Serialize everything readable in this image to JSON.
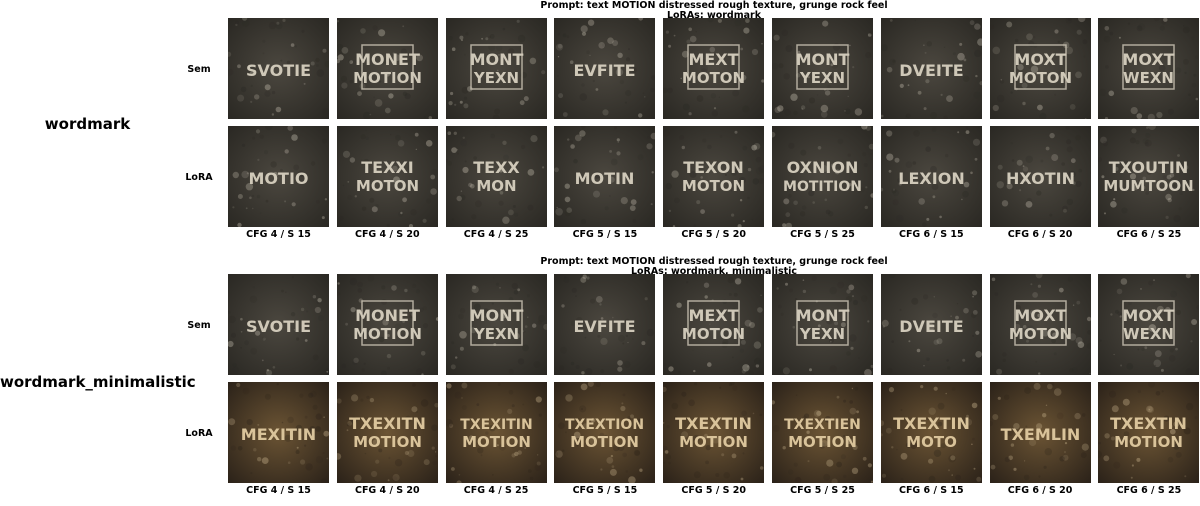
{
  "groups": [
    {
      "name": "wordmark",
      "prompt": "Prompt: text MOTION distressed rough texture, grunge rock feel",
      "loras": "LoRAs: wordmark",
      "rows": [
        {
          "label": "Sem",
          "tint": "gray",
          "tiles": [
            {
              "l1": "SVOTIE",
              "l2": ""
            },
            {
              "l1": "MONET",
              "l2": "MOTION"
            },
            {
              "l1": "MONT",
              "l2": "YEXN"
            },
            {
              "l1": "EVFITE",
              "l2": ""
            },
            {
              "l1": "MEXT",
              "l2": "MOTON"
            },
            {
              "l1": "MONT",
              "l2": "YEXN"
            },
            {
              "l1": "DVEITE",
              "l2": ""
            },
            {
              "l1": "MOXT",
              "l2": "MOTON"
            },
            {
              "l1": "MOXT",
              "l2": "WEXN"
            }
          ]
        },
        {
          "label": "LoRA",
          "tint": "gray",
          "tiles": [
            {
              "l1": "MOTIO",
              "l2": ""
            },
            {
              "l1": "TEXXI",
              "l2": "MOTON"
            },
            {
              "l1": "TEXX",
              "l2": "MON"
            },
            {
              "l1": "MOTIN",
              "l2": ""
            },
            {
              "l1": "TEXON",
              "l2": "MOTON"
            },
            {
              "l1": "OXNION",
              "l2": "MOTITION"
            },
            {
              "l1": "LEXION",
              "l2": ""
            },
            {
              "l1": "HXOTIN",
              "l2": ""
            },
            {
              "l1": "TXOUTIN",
              "l2": "MUMTOON"
            }
          ]
        }
      ],
      "columns": [
        "CFG 4 / S 15",
        "CFG 4 / S 20",
        "CFG 4 / S 25",
        "CFG 5 / S 15",
        "CFG 5 / S 20",
        "CFG 5 / S 25",
        "CFG 6 / S 15",
        "CFG 6 / S 20",
        "CFG 6 / S 25"
      ]
    },
    {
      "name": "wordmark_minimalistic",
      "prompt": "Prompt: text MOTION distressed rough texture, grunge rock feel",
      "loras": "LoRAs: wordmark, minimalistic",
      "rows": [
        {
          "label": "Sem",
          "tint": "gray",
          "tiles": [
            {
              "l1": "SVOTIE",
              "l2": ""
            },
            {
              "l1": "MONET",
              "l2": "MOTION"
            },
            {
              "l1": "MONT",
              "l2": "YEXN"
            },
            {
              "l1": "EVFITE",
              "l2": ""
            },
            {
              "l1": "MEXT",
              "l2": "MOTON"
            },
            {
              "l1": "MONT",
              "l2": "YEXN"
            },
            {
              "l1": "DVEITE",
              "l2": ""
            },
            {
              "l1": "MOXT",
              "l2": "MOTON"
            },
            {
              "l1": "MOXT",
              "l2": "WEXN"
            }
          ]
        },
        {
          "label": "LoRA",
          "tint": "brown",
          "tiles": [
            {
              "l1": "MEXITIN",
              "l2": ""
            },
            {
              "l1": "TXEXITN",
              "l2": "MOTION"
            },
            {
              "l1": "TXEXITIN",
              "l2": "MOTION"
            },
            {
              "l1": "TXEXTION",
              "l2": "MOTION"
            },
            {
              "l1": "TXEXTIN",
              "l2": "MOTION"
            },
            {
              "l1": "TXEXTIEN",
              "l2": "MOTION"
            },
            {
              "l1": "TXEXTIN",
              "l2": "MOTO"
            },
            {
              "l1": "TXEMLIN",
              "l2": ""
            },
            {
              "l1": "TXEXTIN",
              "l2": "MOTION"
            }
          ]
        }
      ],
      "columns": [
        "CFG 4 / S 15",
        "CFG 4 / S 20",
        "CFG 4 / S 25",
        "CFG 5 / S 15",
        "CFG 5 / S 20",
        "CFG 5 / S 25",
        "CFG 6 / S 15",
        "CFG 6 / S 20",
        "CFG 6 / S 25"
      ]
    }
  ],
  "palette": {
    "gray_bg": "#4b473f",
    "gray_dark": "#2a2823",
    "gray_text": "#cfc8b8",
    "brown_bg": "#6b5434",
    "brown_dark": "#2b2219",
    "brown_text": "#d9c39a"
  }
}
